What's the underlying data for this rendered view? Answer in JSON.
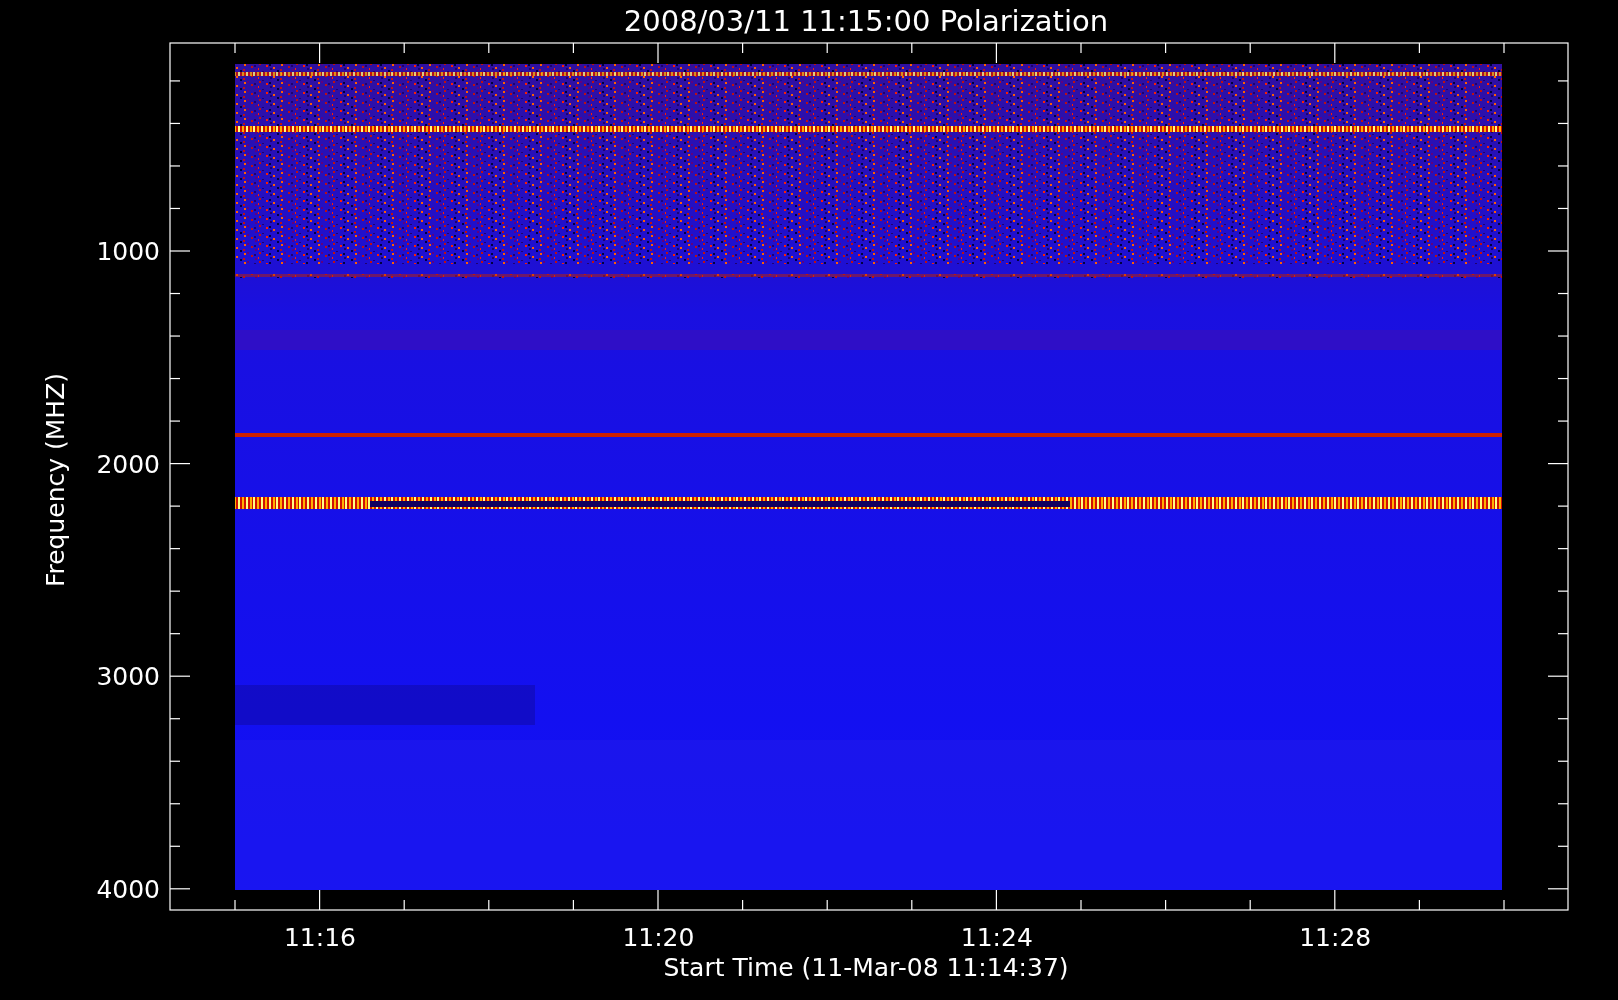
{
  "title": "2008/03/11  11:15:00 Polarization",
  "y_axis": {
    "label": "Frequency (MHZ)",
    "ticks": [
      "1000",
      "2000",
      "3000",
      "4000"
    ]
  },
  "x_axis": {
    "label": "Start Time (11-Mar-08 11:14:37)",
    "ticks": [
      "11:16",
      "11:20",
      "11:24",
      "11:28"
    ]
  }
}
